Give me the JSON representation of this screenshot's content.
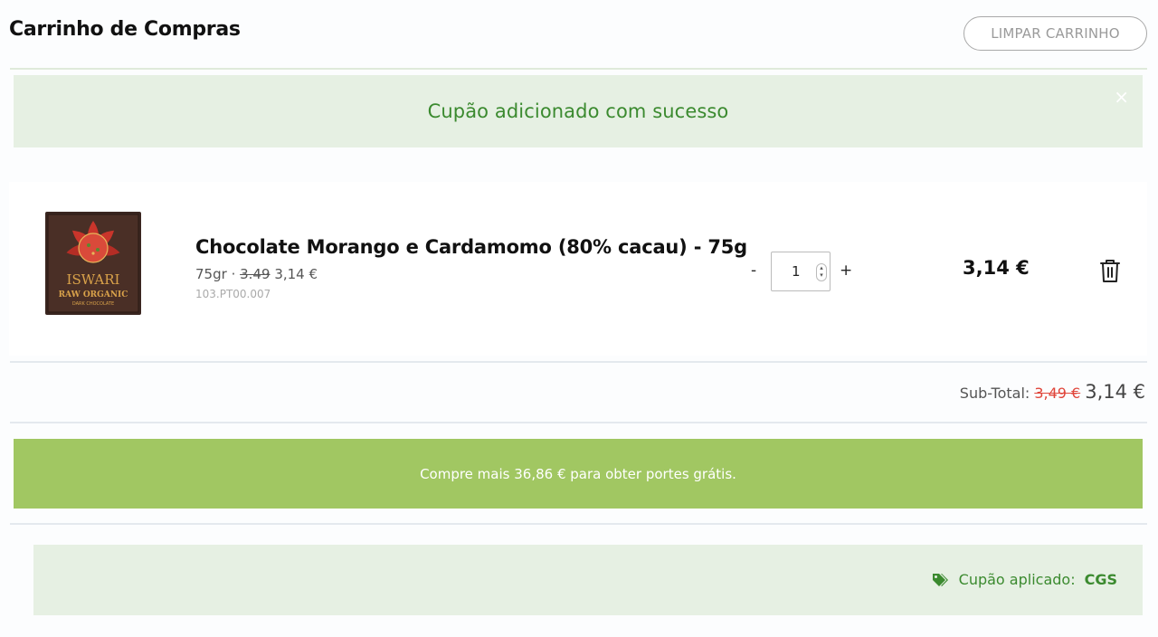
{
  "header": {
    "title": "Carrinho de Compras",
    "clear_label": "LIMPAR CARRINHO"
  },
  "alert": {
    "message": "Cupão adicionado com sucesso",
    "close_symbol": "×"
  },
  "cart": {
    "items": [
      {
        "name": "Chocolate Morango e Cardamomo (80% cacau) - 75g",
        "weight": "75gr",
        "separator": "·",
        "old_price": "3.49",
        "price": "3,14 €",
        "ref": "103.PT00.007",
        "quantity": "1",
        "minus": "-",
        "plus": "+",
        "line_total": "3,14 €",
        "image_logo_text": "ISWARI",
        "image_sub_text": "RAW ORGANIC",
        "image_sub2_text": "DARK CHOCOLATE"
      }
    ]
  },
  "summary": {
    "subtotal_label": "Sub-Total:",
    "subtotal_old": "3,49 €",
    "subtotal_new": "3,14 €"
  },
  "shipping": {
    "message": "Compre mais 36,86 € para obter portes grátis."
  },
  "coupon": {
    "label": "Cupão aplicado:",
    "code": "CGS"
  },
  "colors": {
    "success_green": "#3b8a2f",
    "alert_bg": "#e6f0e3",
    "shipping_bg": "#a1c762",
    "strike_red": "#e0453a"
  }
}
